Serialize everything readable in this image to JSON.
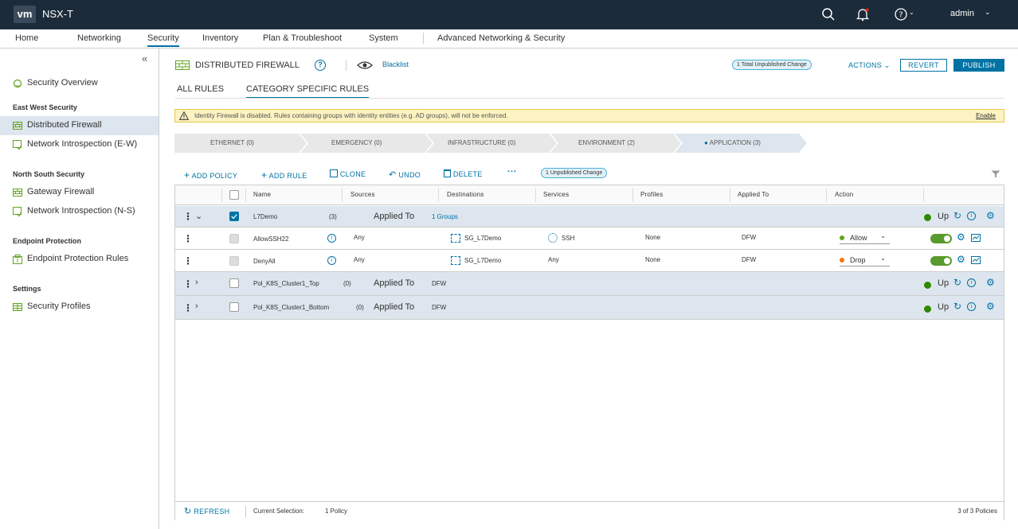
{
  "app": {
    "logo": "vm",
    "title": "NSX-T",
    "user": "admin"
  },
  "nav": {
    "tabs": [
      "Home",
      "Networking",
      "Security",
      "Inventory",
      "Plan & Troubleshoot",
      "System",
      "Advanced Networking & Security"
    ],
    "active": "Security"
  },
  "sidebar": {
    "sections": [
      "East West Security",
      "North South Security",
      "Endpoint Protection",
      "Settings"
    ],
    "items": [
      {
        "label": "Security Overview",
        "icon": "security-overview-icon"
      },
      {
        "label": "Distributed Firewall",
        "icon": "firewall-icon",
        "active": true
      },
      {
        "label": "Network Introspection (E-W)",
        "icon": "introspection-icon"
      },
      {
        "label": "Gateway Firewall",
        "icon": "firewall-icon"
      },
      {
        "label": "Network Introspection (N-S)",
        "icon": "introspection-icon"
      },
      {
        "label": "Endpoint Protection Rules",
        "icon": "endpoint-icon"
      },
      {
        "label": "Security Profiles",
        "icon": "profiles-icon"
      }
    ]
  },
  "header": {
    "title": "DISTRIBUTED FIREWALL",
    "blacklist": "Blacklist",
    "unpublished_total": "1 Total Unpublished Change",
    "actions": "ACTIONS",
    "revert": "REVERT",
    "publish": "PUBLISH"
  },
  "tabs": [
    "ALL RULES",
    "CATEGORY SPECIFIC RULES"
  ],
  "warning": {
    "text": "Identity Firewall is disabled. Rules containing groups with identity entities (e.g. AD groups), will not be enforced.",
    "action": "Enable"
  },
  "categories": [
    "ETHERNET (0)",
    "EMERGENCY (0)",
    "INFRASTRUCTURE (0)",
    "ENVIRONMENT (2)",
    "APPLICATION (3)"
  ],
  "toolbar": {
    "add_policy": "ADD POLICY",
    "add_rule": "ADD RULE",
    "clone": "CLONE",
    "undo": "UNDO",
    "delete": "DELETE",
    "more": "···",
    "unpublished": "1 Unpublished Change"
  },
  "columns": [
    "Name",
    "Sources",
    "Destinations",
    "Services",
    "Profiles",
    "Applied To",
    "Action"
  ],
  "policies": [
    {
      "name": "L7Demo",
      "count": "(3)",
      "applied_label": "Applied To",
      "applied": "1 Groups",
      "status": "Up",
      "rules": [
        {
          "name": "AllowSSH22",
          "sources": "Any",
          "destinations": "SG_L7Demo",
          "services": "SSH",
          "profiles": "None",
          "applied_to": "DFW",
          "action": "Allow"
        },
        {
          "name": "DenyAll",
          "sources": "Any",
          "destinations": "SG_L7Demo",
          "services": "Any",
          "profiles": "None",
          "applied_to": "DFW",
          "action": "Drop"
        }
      ]
    },
    {
      "name": "Pol_K8S_Cluster1_Top",
      "count": "(0)",
      "applied_label": "Applied To",
      "applied": "DFW",
      "status": "Up"
    },
    {
      "name": "Pol_K8S_Cluster1_Bottom",
      "count": "(0)",
      "applied_label": "Applied To",
      "applied": "DFW",
      "status": "Up"
    }
  ],
  "footer": {
    "refresh": "REFRESH",
    "selection_label": "Current Selection:",
    "selection": "1 Policy",
    "count": "3 of 3 Policies"
  },
  "colors": {
    "topbar": "#1c2b3a",
    "accent": "#0072a3",
    "status_up": "#318700",
    "allow": "#62a420",
    "drop": "#f57600"
  }
}
